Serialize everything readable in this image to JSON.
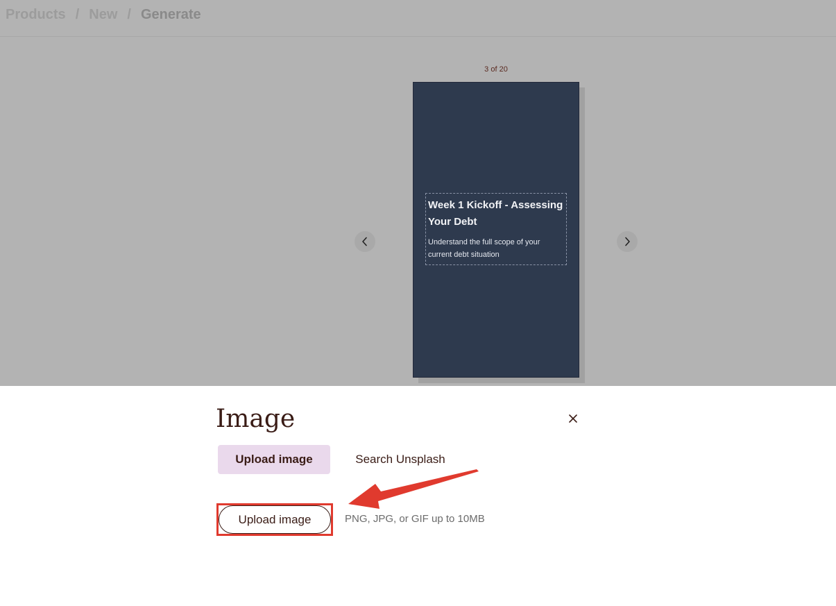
{
  "breadcrumb": {
    "items": [
      "Products",
      "New",
      "Generate"
    ],
    "separator": "/"
  },
  "preview": {
    "counter": "3 of 20",
    "card": {
      "title": "Week 1 Kickoff - Assessing Your Debt",
      "subtitle": "Understand the full scope of your current debt situation",
      "background": "#2e3a4e"
    },
    "prev_icon": "chevron-left-icon",
    "next_icon": "chevron-right-icon"
  },
  "image_panel": {
    "title": "Image",
    "close_icon": "close-icon",
    "tabs": [
      {
        "label": "Upload image",
        "active": true
      },
      {
        "label": "Search Unsplash",
        "active": false
      }
    ],
    "upload_button_label": "Upload image",
    "upload_hint": "PNG, JPG, or GIF up to 10MB"
  },
  "colors": {
    "overlay": "#b3b3b3",
    "accent_text": "#3a1c16",
    "active_tab": "#ead9ec",
    "annotation": "#e03a2e"
  }
}
